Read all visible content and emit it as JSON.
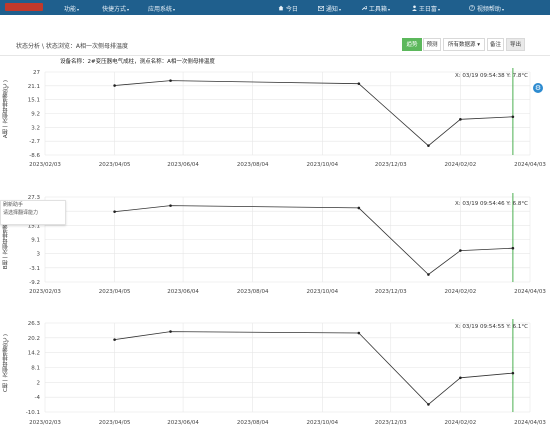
{
  "topbar": {
    "menu": [
      {
        "label": "功能",
        "caret": "▾"
      },
      {
        "label": "快捷方式",
        "caret": "▾"
      },
      {
        "label": "应用系统",
        "caret": "▾"
      }
    ],
    "right": [
      {
        "icon": "home-icon",
        "label": "今日"
      },
      {
        "icon": "mail-icon",
        "label": "通知",
        "caret": "▾"
      },
      {
        "icon": "wrench-icon",
        "label": "工具箱",
        "caret": "▾"
      },
      {
        "icon": "user-icon",
        "label": "王日富",
        "caret": "▾"
      },
      {
        "icon": "question-icon",
        "label": "视频帮助",
        "caret": "▾"
      }
    ]
  },
  "breadcrumb": "状态分析 \\ 状态浏览：A相一次侧母排温度",
  "toolbar": {
    "trend": "趋势",
    "forecast": "预测",
    "all_data": "所有数据源",
    "all_data_caret": "▾",
    "note": "备注",
    "export": "导出"
  },
  "subheader": "设备名称：2#变压器电气成柱，测点名称：A相一次侧母排温度",
  "tooltip": [
    "刷新助手",
    "请选择翻译能力"
  ],
  "colors": {
    "topbar": "#1f5f8d",
    "line": "#333333",
    "cursor": "#4caf50",
    "grid": "#e6e6e6",
    "active": "#5cb85c"
  },
  "chart_data": [
    {
      "type": "line",
      "ylabel": "A相一次侧母排温度(℃)",
      "ylim": [
        -8.6,
        27
      ],
      "yticks": [
        "27",
        "21.1",
        "15.1",
        "9.2",
        "3.2",
        "-2.7",
        "-8.6"
      ],
      "xticks": [
        "2023/02/03",
        "2023/04/05",
        "2023/06/04",
        "2023/08/04",
        "2023/10/04",
        "2023/12/03",
        "2024/02/02",
        "2024/04/03"
      ],
      "x": [
        "2023/04/05",
        "2023/05/24",
        "2023/11/05",
        "2024/01/05",
        "2024/02/02",
        "2024/03/19"
      ],
      "y": [
        21.2,
        23.3,
        22.0,
        -4.6,
        6.7,
        7.8
      ],
      "cursor": {
        "x": "2024/03/19",
        "label": "X: 03/19 09:54:38   Y: 7.8°C"
      }
    },
    {
      "type": "line",
      "ylabel": "B相一次侧母排温度(℃)",
      "ylim": [
        -9.2,
        27.3
      ],
      "yticks": [
        "27.3",
        "21.2",
        "15.1",
        "9.1",
        "3",
        "-3.1",
        "-9.2"
      ],
      "xticks": [
        "2023/02/03",
        "2023/04/05",
        "2023/06/04",
        "2023/08/04",
        "2023/10/04",
        "2023/12/03",
        "2024/02/02",
        "2024/04/03"
      ],
      "x": [
        "2023/04/05",
        "2023/05/24",
        "2023/11/05",
        "2024/01/05",
        "2024/02/02",
        "2024/03/19"
      ],
      "y": [
        21.0,
        23.6,
        22.6,
        -6.0,
        4.3,
        5.3
      ],
      "cursor": {
        "x": "2024/03/19",
        "label": "X: 03/19 09:54:46   Y: 6.8°C"
      }
    },
    {
      "type": "line",
      "ylabel": "C相一次侧母排温度(℃)",
      "ylim": [
        -10.1,
        26.3
      ],
      "yticks": [
        "26.3",
        "20.2",
        "14.2",
        "8.1",
        "2",
        "-4",
        "-10.1"
      ],
      "xticks": [
        "2023/02/03",
        "2023/04/05",
        "2023/06/04",
        "2023/08/04",
        "2023/10/04",
        "2023/12/03",
        "2024/02/02",
        "2024/04/03"
      ],
      "x": [
        "2023/04/05",
        "2023/05/24",
        "2023/11/05",
        "2024/01/05",
        "2024/02/02",
        "2024/03/19"
      ],
      "y": [
        19.5,
        22.8,
        22.2,
        -7.0,
        3.9,
        5.8
      ],
      "cursor": {
        "x": "2024/03/19",
        "label": "X: 03/19 09:54:55   Y: 6.1°C"
      }
    }
  ]
}
